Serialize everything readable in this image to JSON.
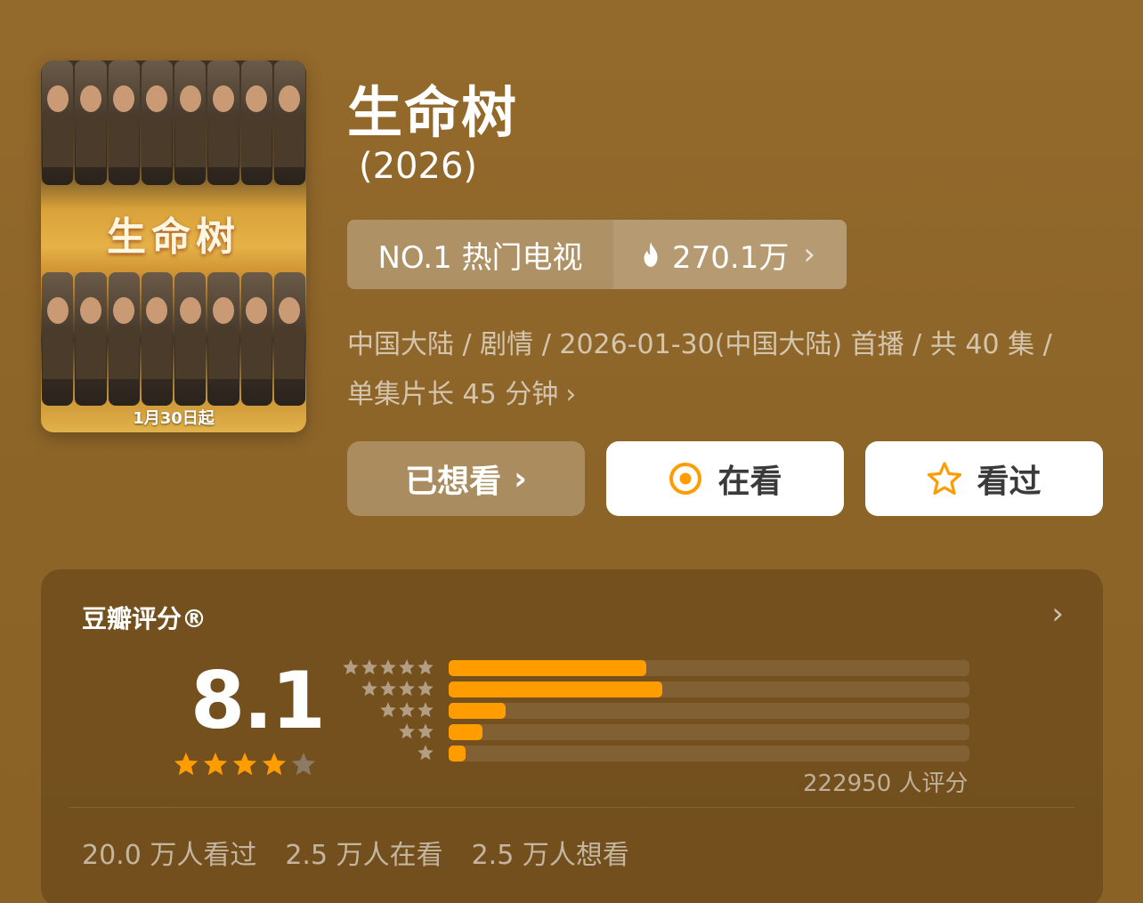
{
  "poster": {
    "title_art": "生命树",
    "date_text": "1月30日起"
  },
  "header": {
    "title": "生命树",
    "year": "(2026)"
  },
  "rank": {
    "label": "NO.1 热门电视",
    "heat": "270.1万",
    "chevron": "›"
  },
  "meta": {
    "line1": "中国大陆 / 剧情 / 2026-01-30(中国大陆) 首播 / 共 40 集 /",
    "line2": "单集片长 45 分钟",
    "chevron": "›"
  },
  "buttons": {
    "want": "已想看",
    "want_chevron": "›",
    "doing": "在看",
    "done": "看过"
  },
  "rating": {
    "title": "豆瓣评分®",
    "chevron": "›",
    "score": "8.1",
    "stars_filled": 4,
    "distribution": [
      {
        "stars": 5,
        "fraction": 0.38
      },
      {
        "stars": 4,
        "fraction": 0.41
      },
      {
        "stars": 3,
        "fraction": 0.11
      },
      {
        "stars": 2,
        "fraction": 0.065
      },
      {
        "stars": 1,
        "fraction": 0.033
      }
    ],
    "count": "222950 人评分",
    "stats": [
      "20.0 万人看过",
      "2.5 万人在看",
      "2.5 万人想看"
    ]
  },
  "colors": {
    "accent": "#ff9c00",
    "background": "#946a2c",
    "star_empty": "#8a7a66"
  }
}
